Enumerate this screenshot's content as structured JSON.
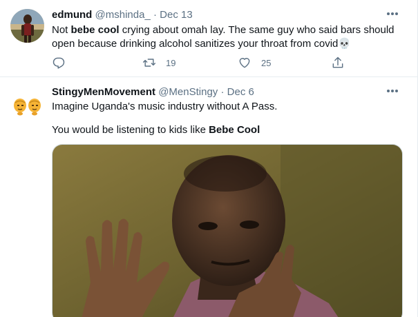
{
  "tweets": [
    {
      "name": "edmund",
      "handle": "@mshinda_",
      "separator": "·",
      "date": "Dec 13",
      "text_pre": "Not ",
      "text_bold": "bebe cool",
      "text_post": " crying about omah lay. The same guy who said bars should open because  drinking alcohol sanitizes your throat from covid💀",
      "retweets": "19",
      "likes": "25",
      "icons": {
        "reply": "reply-icon",
        "retweet": "retweet-icon",
        "like": "heart-icon",
        "share": "share-icon",
        "more": "more-icon"
      }
    },
    {
      "name": "StingyMenMovement",
      "handle": "@MenStingy",
      "separator": "·",
      "date": "Dec 6",
      "line1": "Imagine Uganda's music industry without A Pass.",
      "line2_pre": "You would be listening to kids like ",
      "line2_bold": "Bebe Cool",
      "more": "more-icon"
    }
  ],
  "colors": {
    "text": "#0f1419",
    "secondary": "#5b7083",
    "border": "#e6ecf0"
  }
}
